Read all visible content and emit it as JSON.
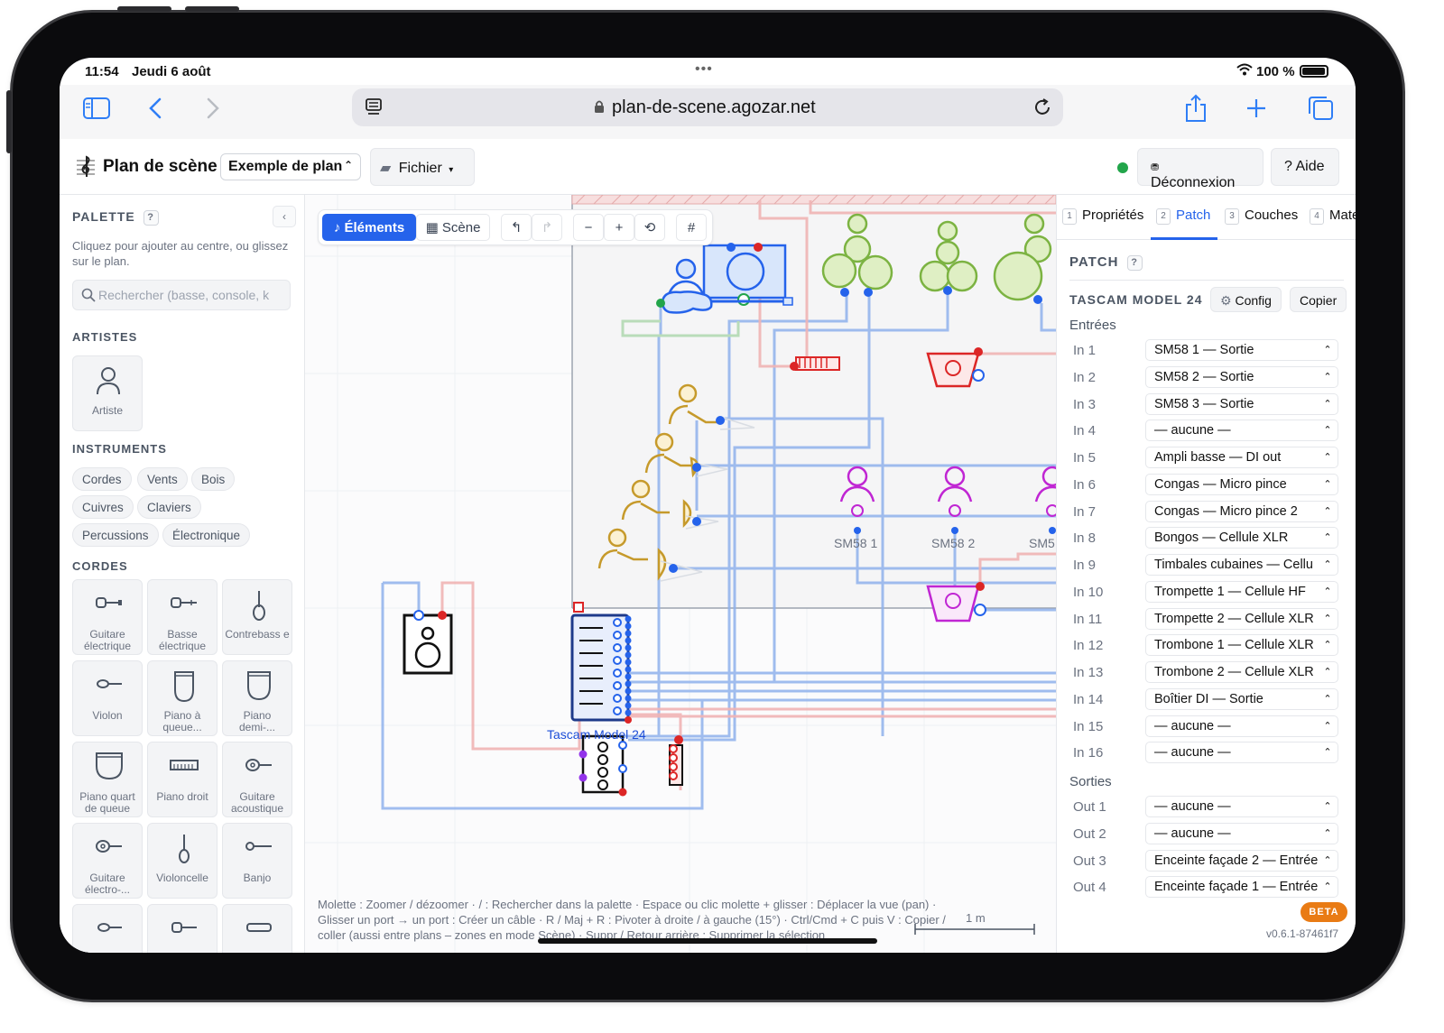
{
  "status_bar": {
    "time": "11:54",
    "date": "Jeudi 6 août",
    "battery": "100 %"
  },
  "browser": {
    "url": "plan-de-scene.agozar.net"
  },
  "header": {
    "app_title": "Plan de scène",
    "plan_select": "Exemple de plan",
    "file_menu": "Fichier",
    "logout": "Déconnexion",
    "help": "? Aide",
    "status_color": "#22a54a"
  },
  "palette": {
    "title": "PALETTE",
    "help_badge": "?",
    "collapse": "‹",
    "help_text": "Cliquez pour ajouter au centre, ou glissez sur le plan.",
    "search_placeholder": "Rechercher (basse, console, k",
    "artists_title": "ARTISTES",
    "artist_tile": "Artiste",
    "instruments_title": "INSTRUMENTS",
    "filters": [
      "Cordes",
      "Vents",
      "Bois",
      "Cuivres",
      "Claviers",
      "Percussions",
      "Électronique"
    ],
    "strings_title": "CORDES",
    "tiles": [
      "Guitare électrique",
      "Basse électrique",
      "Contrebass e",
      "Violon",
      "Piano à queue...",
      "Piano demi-...",
      "Piano quart de queue",
      "Piano droit",
      "Guitare acoustique",
      "Guitare électro-...",
      "Violoncelle",
      "Banjo"
    ]
  },
  "canvas": {
    "toolbar": {
      "elements": "♪ Éléments",
      "scene": "▦ Scène",
      "undo": "↰",
      "redo": "↱",
      "zoom_out": "−",
      "zoom_in": "+",
      "reset": "⟲",
      "grid": "#"
    },
    "labels": {
      "mic1": "SM58 1",
      "mic2": "SM58 2",
      "mic3": "SM5",
      "console": "Tascam Model 24"
    },
    "hint": "Molette : Zoomer / dézoomer · / : Rechercher dans la palette · Espace ou clic molette + glisser : Déplacer la vue (pan) · Glisser un port → un port : Créer un câble · R / Maj + R : Pivoter à droite / à gauche (15°) · Ctrl/Cmd + C puis V : Copier / coller (aussi entre plans – zones en mode Scène) · Suppr / Retour arrière : Supprimer la sélection",
    "scale": "1 m"
  },
  "right_panel": {
    "tabs": [
      {
        "num": "1",
        "label": "Propriétés"
      },
      {
        "num": "2",
        "label": "Patch"
      },
      {
        "num": "3",
        "label": "Couches"
      },
      {
        "num": "4",
        "label": "Mate"
      }
    ],
    "patch_title": "PATCH",
    "help_badge": "?",
    "device": "TASCAM MODEL 24",
    "config_btn": "Config",
    "copy_btn": "Copier",
    "inputs_title": "Entrées",
    "inputs": [
      {
        "label": "In 1",
        "value": "SM58 1 — Sortie"
      },
      {
        "label": "In 2",
        "value": "SM58 2 — Sortie"
      },
      {
        "label": "In 3",
        "value": "SM58 3 — Sortie"
      },
      {
        "label": "In 4",
        "value": "— aucune —"
      },
      {
        "label": "In 5",
        "value": "Ampli basse — DI out"
      },
      {
        "label": "In 6",
        "value": "Congas — Micro pince"
      },
      {
        "label": "In 7",
        "value": "Congas — Micro pince 2"
      },
      {
        "label": "In 8",
        "value": "Bongos — Cellule XLR"
      },
      {
        "label": "In 9",
        "value": "Timbales cubaines — Cellu"
      },
      {
        "label": "In 10",
        "value": "Trompette 1 — Cellule HF"
      },
      {
        "label": "In 11",
        "value": "Trompette 2 — Cellule XLR"
      },
      {
        "label": "In 12",
        "value": "Trombone 1 — Cellule XLR"
      },
      {
        "label": "In 13",
        "value": "Trombone 2 — Cellule XLR"
      },
      {
        "label": "In 14",
        "value": "Boîtier DI — Sortie"
      },
      {
        "label": "In 15",
        "value": "— aucune —"
      },
      {
        "label": "In 16",
        "value": "— aucune —"
      }
    ],
    "outputs_title": "Sorties",
    "outputs": [
      {
        "label": "Out 1",
        "value": "— aucune —"
      },
      {
        "label": "Out 2",
        "value": "— aucune —"
      },
      {
        "label": "Out 3",
        "value": "Enceinte façade 2 — Entrée"
      },
      {
        "label": "Out 4",
        "value": "Enceinte façade 1 — Entrée"
      }
    ],
    "beta": "BETA",
    "version": "v0.6.1-87461f7"
  }
}
